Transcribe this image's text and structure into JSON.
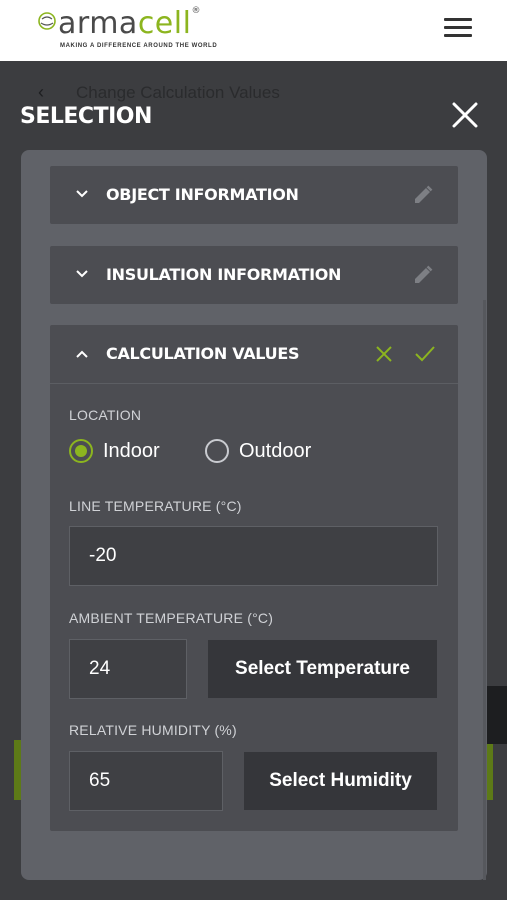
{
  "header": {
    "logo_text_dark": "arma",
    "logo_text_green": "cell",
    "logo_reg": "®",
    "logo_tagline": "MAKING A DIFFERENCE AROUND THE WORLD",
    "brand_color": "#8cb51f",
    "menu_icon": "hamburger-menu-icon"
  },
  "background": {
    "back_icon": "chevron-left-icon",
    "title": "Change Calculation Values"
  },
  "modal": {
    "title": "SELECTION",
    "close_icon": "close-icon",
    "sections": [
      {
        "title": "OBJECT INFORMATION",
        "expanded": false,
        "action_icon": "pencil-icon"
      },
      {
        "title": "INSULATION INFORMATION",
        "expanded": false,
        "action_icon": "pencil-icon"
      },
      {
        "title": "CALCULATION VALUES",
        "expanded": true,
        "action_icons": [
          "cancel-x-icon",
          "confirm-check-icon"
        ]
      }
    ]
  },
  "calc": {
    "location_label": "LOCATION",
    "location_options": [
      "Indoor",
      "Outdoor"
    ],
    "location_selected": "Indoor",
    "line_temp_label": "LINE TEMPERATURE (°C)",
    "line_temp_value": "-20",
    "ambient_temp_label": "AMBIENT TEMPERATURE (°C)",
    "ambient_temp_value": "24",
    "select_temp_button": "Select Temperature",
    "humidity_label": "RELATIVE HUMIDITY (%)",
    "humidity_value": "65",
    "select_humidity_button": "Select Humidity"
  }
}
